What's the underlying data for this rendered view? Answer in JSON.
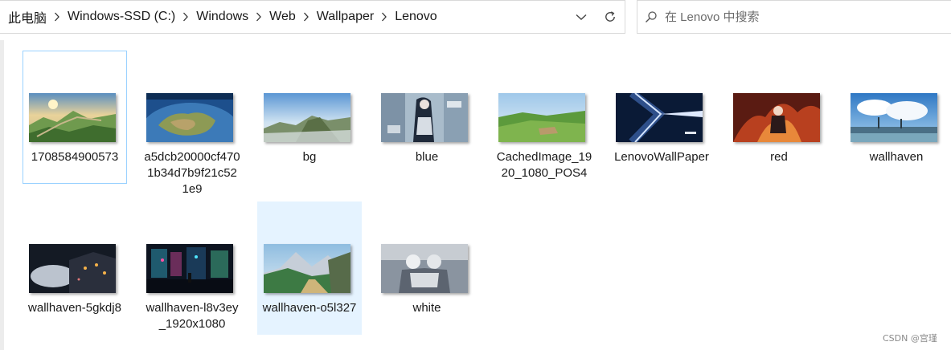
{
  "breadcrumb": [
    "此电脑",
    "Windows-SSD (C:)",
    "Windows",
    "Web",
    "Wallpaper",
    "Lenovo"
  ],
  "search": {
    "placeholder": "在 Lenovo 中搜索"
  },
  "icons": {
    "separator": "chevron-right-icon",
    "history": "chevron-down-icon",
    "refresh": "refresh-icon",
    "search": "search-icon"
  },
  "files": [
    {
      "name": "1708584900573",
      "state": "focused"
    },
    {
      "name": "a5dcb20000cf4701b34d7b9f21c521e9",
      "state": ""
    },
    {
      "name": "bg",
      "state": ""
    },
    {
      "name": "blue",
      "state": ""
    },
    {
      "name": "CachedImage_1920_1080_POS4",
      "state": ""
    },
    {
      "name": "LenovoWallPaper",
      "state": ""
    },
    {
      "name": "red",
      "state": ""
    },
    {
      "name": "wallhaven",
      "state": ""
    },
    {
      "name": "wallhaven-5gkdj8",
      "state": ""
    },
    {
      "name": "wallhaven-l8v3ey_1920x1080",
      "state": ""
    },
    {
      "name": "wallhaven-o5l327",
      "state": "selected"
    },
    {
      "name": "white",
      "state": ""
    }
  ],
  "watermark": "CSDN @宫瑾",
  "colors": {
    "selection": "#e5f3ff",
    "focus_border": "#99d1ff"
  }
}
